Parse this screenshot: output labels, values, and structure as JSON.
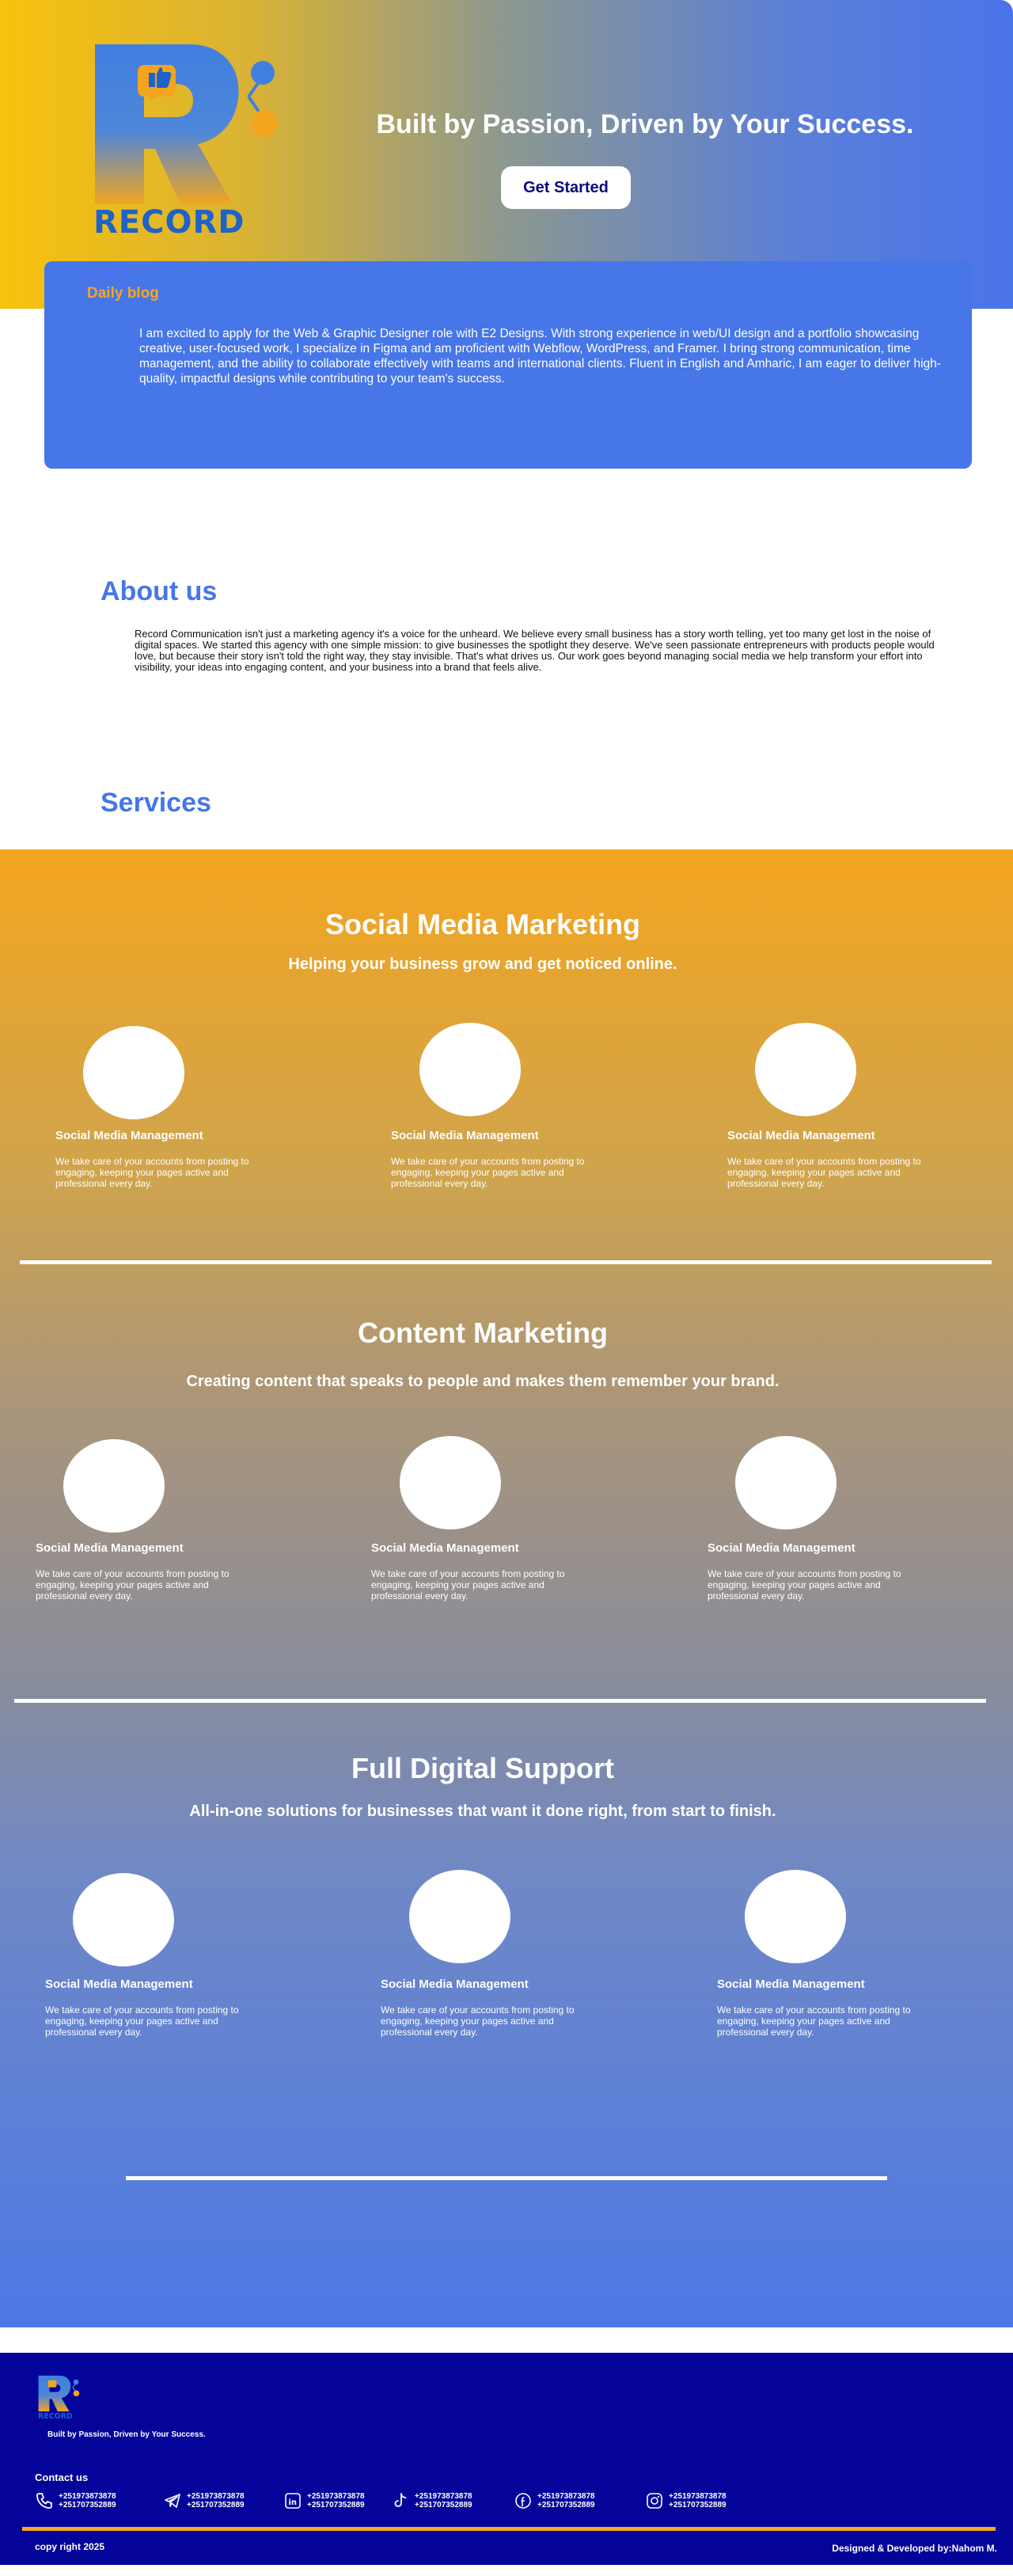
{
  "hero": {
    "logo_word": "RECORD",
    "title": "Built by Passion, Driven by Your Success.",
    "cta_label": "Get Started"
  },
  "blog": {
    "title": "Daily blog",
    "text": "I am excited to apply for the Web & Graphic Designer role with E2 Designs. With strong experience in web/UI design and a portfolio showcasing creative, user-focused work, I specialize in Figma and am proficient with Webflow, WordPress, and Framer. I bring strong communication, time management, and the ability to collaborate effectively with teams and international clients. Fluent in English and Amharic, I am eager to deliver high-quality, impactful designs while contributing to your team's success."
  },
  "about": {
    "title": "About us",
    "text": "Record Communication isn't just a marketing agency it's a voice for the unheard. We believe every small business has a story worth telling, yet too many get lost in the noise of digital spaces. We started this agency with one simple mission: to give businesses the spotlight they deserve. We've seen passionate entrepreneurs with products people would love, but because their story isn't told the right way, they stay invisible. That's what drives us. Our work goes beyond managing social media we help transform your effort into visibility, your ideas into engaging content, and your business into a brand that feels alive."
  },
  "services": {
    "title": "Services",
    "sections": [
      {
        "title": "Social Media Marketing",
        "subtitle": "Helping your business grow and get noticed online.",
        "cards": [
          {
            "title": "Social Media Management",
            "text": "We take care of your accounts from posting to engaging, keeping your pages active and professional every day."
          },
          {
            "title": "Social Media Management",
            "text": "We take care of your accounts from posting to engaging, keeping your pages active and professional every day."
          },
          {
            "title": "Social Media Management",
            "text": "We take care of your accounts from posting to engaging, keeping your pages active and professional every day."
          }
        ]
      },
      {
        "title": "Content Marketing",
        "subtitle": "Creating content that speaks to people and makes them remember your brand.",
        "cards": [
          {
            "title": "Social Media Management",
            "text": "We take care of your accounts from posting to engaging, keeping your pages active and professional every day."
          },
          {
            "title": "Social Media Management",
            "text": "We take care of your accounts from posting to engaging, keeping your pages active and professional every day."
          },
          {
            "title": "Social Media Management",
            "text": "We take care of your accounts from posting to engaging, keeping your pages active and professional every day."
          }
        ]
      },
      {
        "title": "Full Digital Support",
        "subtitle": "All-in-one solutions for businesses that want it done right, from start to finish.",
        "cards": [
          {
            "title": "Social Media Management",
            "text": "We take care of your accounts from posting to engaging, keeping your pages active and professional every day."
          },
          {
            "title": "Social Media Management",
            "text": "We take care of your accounts from posting to engaging, keeping your pages active and professional every day."
          },
          {
            "title": "Social Media Management",
            "text": "We take care of your accounts from posting to engaging, keeping your pages active and professional every day."
          }
        ]
      }
    ]
  },
  "footer": {
    "logo_word": "RECORD",
    "tagline": "Built by Passion, Driven by Your Success.",
    "contact_label": "Contact us",
    "contacts": [
      {
        "icon": "phone-icon",
        "line1": "+251973873878",
        "line2": "+251707352889"
      },
      {
        "icon": "telegram-icon",
        "line1": "+251973873878",
        "line2": "+251707352889"
      },
      {
        "icon": "linkedin-icon",
        "line1": "+251973873878",
        "line2": "+251707352889"
      },
      {
        "icon": "tiktok-icon",
        "line1": "+251973873878",
        "line2": "+251707352889"
      },
      {
        "icon": "facebook-icon",
        "line1": "+251973873878",
        "line2": "+251707352889"
      },
      {
        "icon": "instagram-icon",
        "line1": "+251973873878",
        "line2": "+251707352889"
      }
    ],
    "copyright": "copy right 2025",
    "credit": "Designed & Developed by:Nahom M."
  },
  "colors": {
    "brand_blue": "#4676e8",
    "accent_orange": "#f5a623",
    "navy": "#04049a",
    "hero_start": "#f8c20c"
  }
}
